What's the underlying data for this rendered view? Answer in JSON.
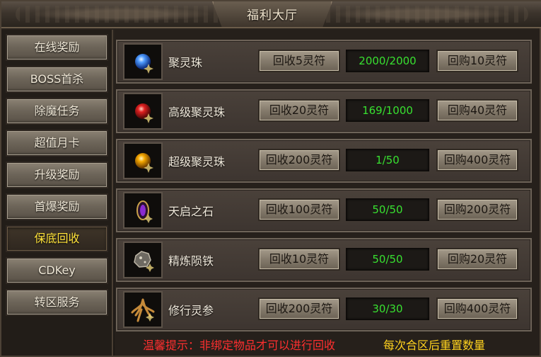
{
  "window": {
    "title": "福利大厅"
  },
  "sidebar": {
    "items": [
      {
        "label": "在线奖励",
        "active": false
      },
      {
        "label": "BOSS首杀",
        "active": false
      },
      {
        "label": "除魔任务",
        "active": false
      },
      {
        "label": "超值月卡",
        "active": false
      },
      {
        "label": "升级奖励",
        "active": false
      },
      {
        "label": "首爆奖励",
        "active": false
      },
      {
        "label": "保底回收",
        "active": true
      },
      {
        "label": "CDKey",
        "active": false
      },
      {
        "label": "转区服务",
        "active": false
      }
    ]
  },
  "rows": [
    {
      "name": "聚灵珠",
      "icon": "blue-orb-icon",
      "recycle_label": "回收5灵符",
      "count": "2000/2000",
      "buy_label": "回购10灵符"
    },
    {
      "name": "高级聚灵珠",
      "icon": "red-orb-icon",
      "recycle_label": "回收20灵符",
      "count": "169/1000",
      "buy_label": "回购40灵符"
    },
    {
      "name": "超级聚灵珠",
      "icon": "gold-orb-icon",
      "recycle_label": "回收200灵符",
      "count": "1/50",
      "buy_label": "回购400灵符"
    },
    {
      "name": "天启之石",
      "icon": "purple-stone-icon",
      "recycle_label": "回收100灵符",
      "count": "50/50",
      "buy_label": "回购200灵符"
    },
    {
      "name": "精炼陨铁",
      "icon": "meteor-iron-icon",
      "recycle_label": "回收10灵符",
      "count": "50/50",
      "buy_label": "回购20灵符"
    },
    {
      "name": "修行灵参",
      "icon": "ginseng-icon",
      "recycle_label": "回收200灵符",
      "count": "30/30",
      "buy_label": "回购400灵符"
    }
  ],
  "footer": {
    "tip": "温馨提示：非绑定物品才可以进行回收",
    "reset_note": "每次合区后重置数量"
  },
  "colors": {
    "active_tab_text": "#ffe23a",
    "count_text": "#38e030",
    "tip_red": "#ff2f2f",
    "note_yellow": "#ffd21e"
  }
}
